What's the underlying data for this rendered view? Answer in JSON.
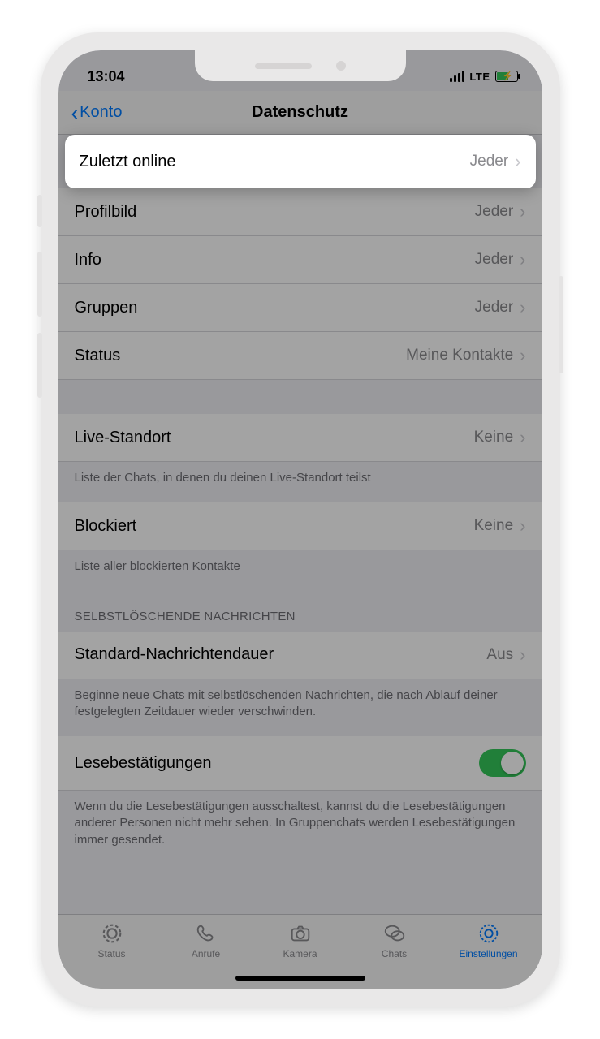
{
  "status": {
    "time": "13:04",
    "network": "LTE"
  },
  "nav": {
    "back_label": "Konto",
    "title": "Datenschutz"
  },
  "rows": {
    "last_seen": {
      "label": "Zuletzt online",
      "value": "Jeder"
    },
    "profile_pic": {
      "label": "Profilbild",
      "value": "Jeder"
    },
    "info": {
      "label": "Info",
      "value": "Jeder"
    },
    "groups": {
      "label": "Gruppen",
      "value": "Jeder"
    },
    "status": {
      "label": "Status",
      "value": "Meine Kontakte"
    },
    "live_loc": {
      "label": "Live-Standort",
      "value": "Keine"
    },
    "blocked": {
      "label": "Blockiert",
      "value": "Keine"
    },
    "msg_timer": {
      "label": "Standard-Nachrichtendauer",
      "value": "Aus"
    },
    "read_rec": {
      "label": "Lesebestätigungen"
    }
  },
  "footers": {
    "live_loc": "Liste der Chats, in denen du deinen Live-Standort teilst",
    "blocked": "Liste aller blockierten Kontakte",
    "msg_timer": "Beginne neue Chats mit selbstlöschenden Nachrichten, die nach Ablauf deiner festgelegten Zeitdauer wieder verschwinden.",
    "read_rec": "Wenn du die Lesebestätigungen ausschaltest, kannst du die Lesebestätigungen anderer Personen nicht mehr sehen. In Gruppenchats werden Lesebestätigungen immer gesendet."
  },
  "section_headers": {
    "disappearing": "SELBSTLÖSCHENDE NACHRICHTEN"
  },
  "tabs": {
    "status": "Status",
    "calls": "Anrufe",
    "camera": "Kamera",
    "chats": "Chats",
    "settings": "Einstellungen"
  }
}
